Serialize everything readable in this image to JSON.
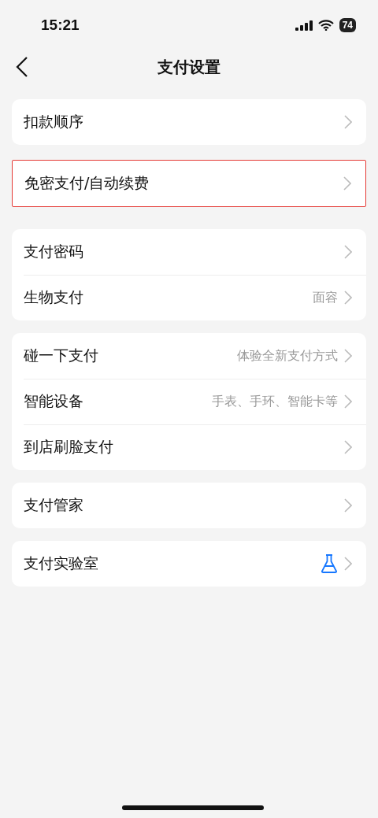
{
  "status_bar": {
    "time": "15:21",
    "battery": "74"
  },
  "nav": {
    "title": "支付设置"
  },
  "groups": [
    {
      "highlighted": false,
      "items": [
        {
          "kind": "plain",
          "label": "扣款顺序"
        }
      ]
    },
    {
      "highlighted": true,
      "items": [
        {
          "kind": "plain",
          "label": "免密支付/自动续费"
        }
      ]
    },
    {
      "highlighted": false,
      "items": [
        {
          "kind": "plain",
          "label": "支付密码"
        },
        {
          "kind": "plain",
          "label": "生物支付",
          "value": "面容"
        }
      ]
    },
    {
      "highlighted": false,
      "items": [
        {
          "kind": "plain",
          "label": "碰一下支付",
          "value": "体验全新支付方式"
        },
        {
          "kind": "plain",
          "label": "智能设备",
          "value": "手表、手环、智能卡等"
        },
        {
          "kind": "plain",
          "label": "到店刷脸支付"
        }
      ]
    },
    {
      "highlighted": false,
      "items": [
        {
          "kind": "plain",
          "label": "支付管家"
        }
      ]
    },
    {
      "highlighted": false,
      "items": [
        {
          "kind": "lab",
          "label": "支付实验室"
        }
      ]
    }
  ]
}
